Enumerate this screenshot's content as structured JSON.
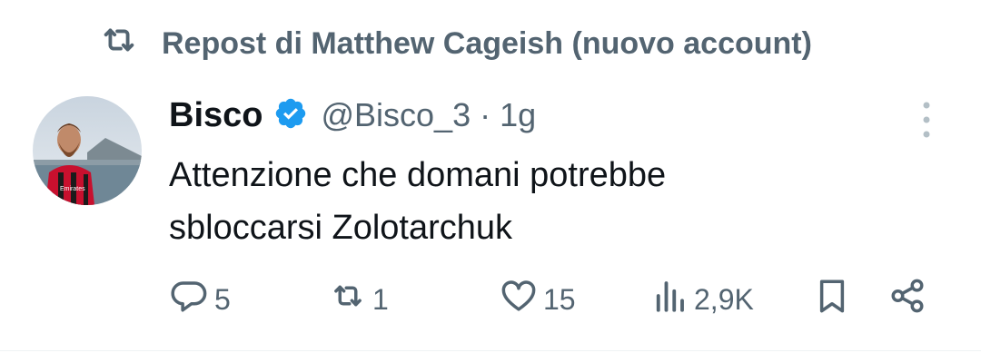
{
  "repost": {
    "icon": "repost-icon",
    "label": "Repost di Matthew Cageish (nuovo account)"
  },
  "tweet": {
    "avatar_icon": "avatar",
    "author_name": "Bisco",
    "verified_icon": "verified-badge-icon",
    "handle": "@Bisco_3",
    "separator": "·",
    "time": "1g",
    "text_lines": [
      "Attenzione che domani potrebbe",
      "sbloccarsi Zolotarchuk"
    ],
    "more_icon": "more-options-icon"
  },
  "actions": {
    "reply": {
      "icon": "reply-icon",
      "count": "5"
    },
    "repost": {
      "icon": "repost-icon",
      "count": "1"
    },
    "like": {
      "icon": "heart-icon",
      "count": "15"
    },
    "views": {
      "icon": "views-icon",
      "count": "2,9K"
    },
    "bookmark": {
      "icon": "bookmark-icon"
    },
    "share": {
      "icon": "share-icon"
    }
  },
  "colors": {
    "text_primary": "#0f1419",
    "text_secondary": "#536471",
    "verified_blue": "#1d9bf0"
  }
}
